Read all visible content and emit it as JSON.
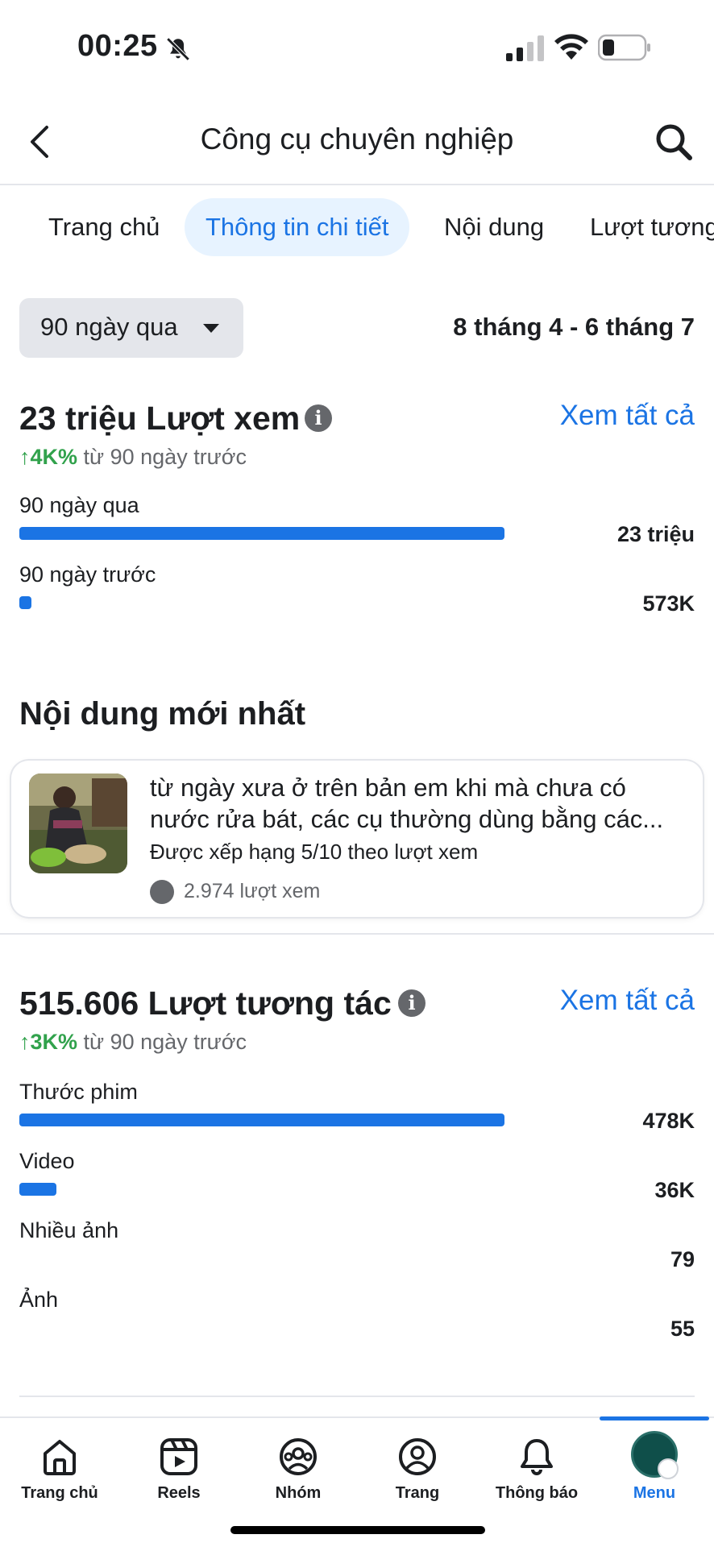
{
  "status_bar": {
    "time": "00:25"
  },
  "header": {
    "title": "Công cụ chuyên nghiệp"
  },
  "tabs": [
    {
      "label": "Trang chủ"
    },
    {
      "label": "Thông tin chi tiết"
    },
    {
      "label": "Nội dung"
    },
    {
      "label": "Lượt tương"
    }
  ],
  "active_tab": "Thông tin chi tiết",
  "filter": {
    "range_label": "90 ngày qua",
    "date_range": "8 tháng 4 - 6 tháng 7"
  },
  "views": {
    "title": "23 triệu Lượt xem",
    "see_all": "Xem tất cả",
    "change_value": "↑4K%",
    "change_text": " từ 90 ngày trước",
    "rows": [
      {
        "label": "90 ngày qua",
        "value": "23 triệu",
        "fraction": 1.0
      },
      {
        "label": "90 ngày trước",
        "value": "573K",
        "fraction": 0.025
      }
    ]
  },
  "latest": {
    "title": "Nội dung mới nhất",
    "caption": "từ ngày xưa ở trên bản em khi mà chưa có nước rửa bát, các cụ thường dùng bằng các...",
    "rank": "Được xếp hạng 5/10 theo lượt xem",
    "views": "2.974 lượt xem"
  },
  "interactions": {
    "title": "515.606 Lượt tương tác",
    "see_all": "Xem tất cả",
    "change_value": "↑3K%",
    "change_text": " từ 90 ngày trước",
    "rows": [
      {
        "label": "Thước phim",
        "value": "478K",
        "fraction": 1.0
      },
      {
        "label": "Video",
        "value": "36K",
        "fraction": 0.076
      },
      {
        "label": "Nhiều ảnh",
        "value": "79",
        "fraction": 0
      },
      {
        "label": "Ảnh",
        "value": "55",
        "fraction": 0
      }
    ]
  },
  "bottom_nav": [
    {
      "label": "Trang chủ",
      "icon": "home-icon"
    },
    {
      "label": "Reels",
      "icon": "reels-icon"
    },
    {
      "label": "Nhóm",
      "icon": "groups-icon"
    },
    {
      "label": "Trang",
      "icon": "page-icon"
    },
    {
      "label": "Thông báo",
      "icon": "bell-icon"
    },
    {
      "label": "Menu",
      "icon": "avatar"
    }
  ],
  "active_nav": "Menu",
  "colors": {
    "accent": "#1b74e4",
    "positive": "#31a24c",
    "muted": "#65676b"
  }
}
